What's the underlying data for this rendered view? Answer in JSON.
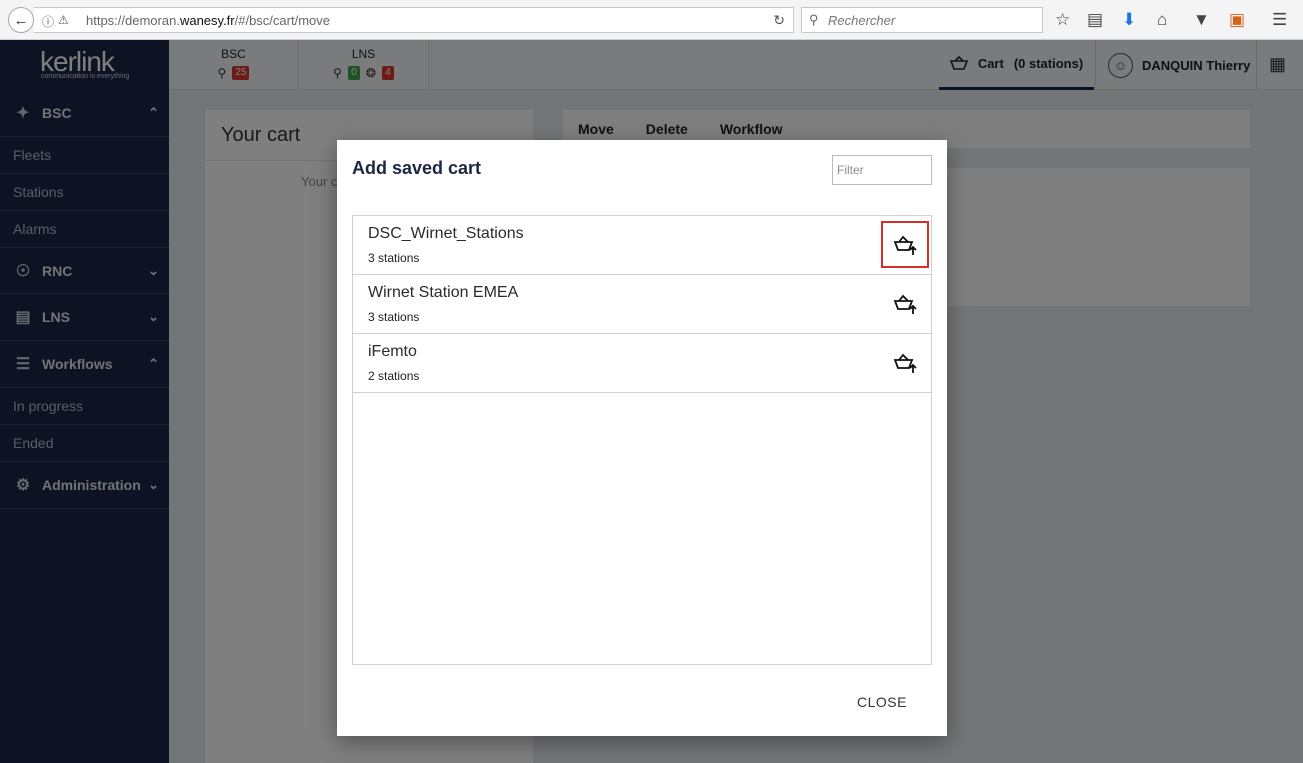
{
  "browser": {
    "url_prefix": "https://demoran.",
    "url_host": "wanesy.fr",
    "url_path": "/#/bsc/cart/move",
    "search_placeholder": "Rechercher"
  },
  "header": {
    "logo_text": "kerlink",
    "logo_tagline": "communication is everything",
    "bsc": {
      "label": "BSC",
      "count": "25"
    },
    "lns": {
      "label": "LNS",
      "green_count": "0",
      "red_count": "4"
    },
    "cart_label": "Cart",
    "cart_count": "(0 stations)",
    "user_name": "DANQUIN Thierry"
  },
  "sidebar": {
    "bsc": "BSC",
    "bsc_items": [
      "Fleets",
      "Stations",
      "Alarms"
    ],
    "rnc": "RNC",
    "lns": "LNS",
    "workflows": "Workflows",
    "workflow_items": [
      "In progress",
      "Ended"
    ],
    "administration": "Administration"
  },
  "main": {
    "your_cart_title": "Your cart",
    "your_cart_empty": "Your c",
    "actions": [
      "Move",
      "Delete",
      "Workflow"
    ]
  },
  "modal": {
    "title": "Add saved cart",
    "filter_placeholder": "Filter",
    "carts": [
      {
        "name": "DSC_Wirnet_Stations",
        "count": "3 stations"
      },
      {
        "name": "Wirnet Station EMEA",
        "count": "3 stations"
      },
      {
        "name": "iFemto",
        "count": "2 stations"
      }
    ],
    "close_label": "CLOSE"
  },
  "colors": {
    "navy": "#1b2744",
    "badge_red": "#d9372d",
    "badge_green": "#3ea64a",
    "highlight": "#d32f2f"
  },
  "icons": {
    "load_cart": "cart-upload-icon",
    "net": "network-icon",
    "radio": "radio-icon"
  }
}
